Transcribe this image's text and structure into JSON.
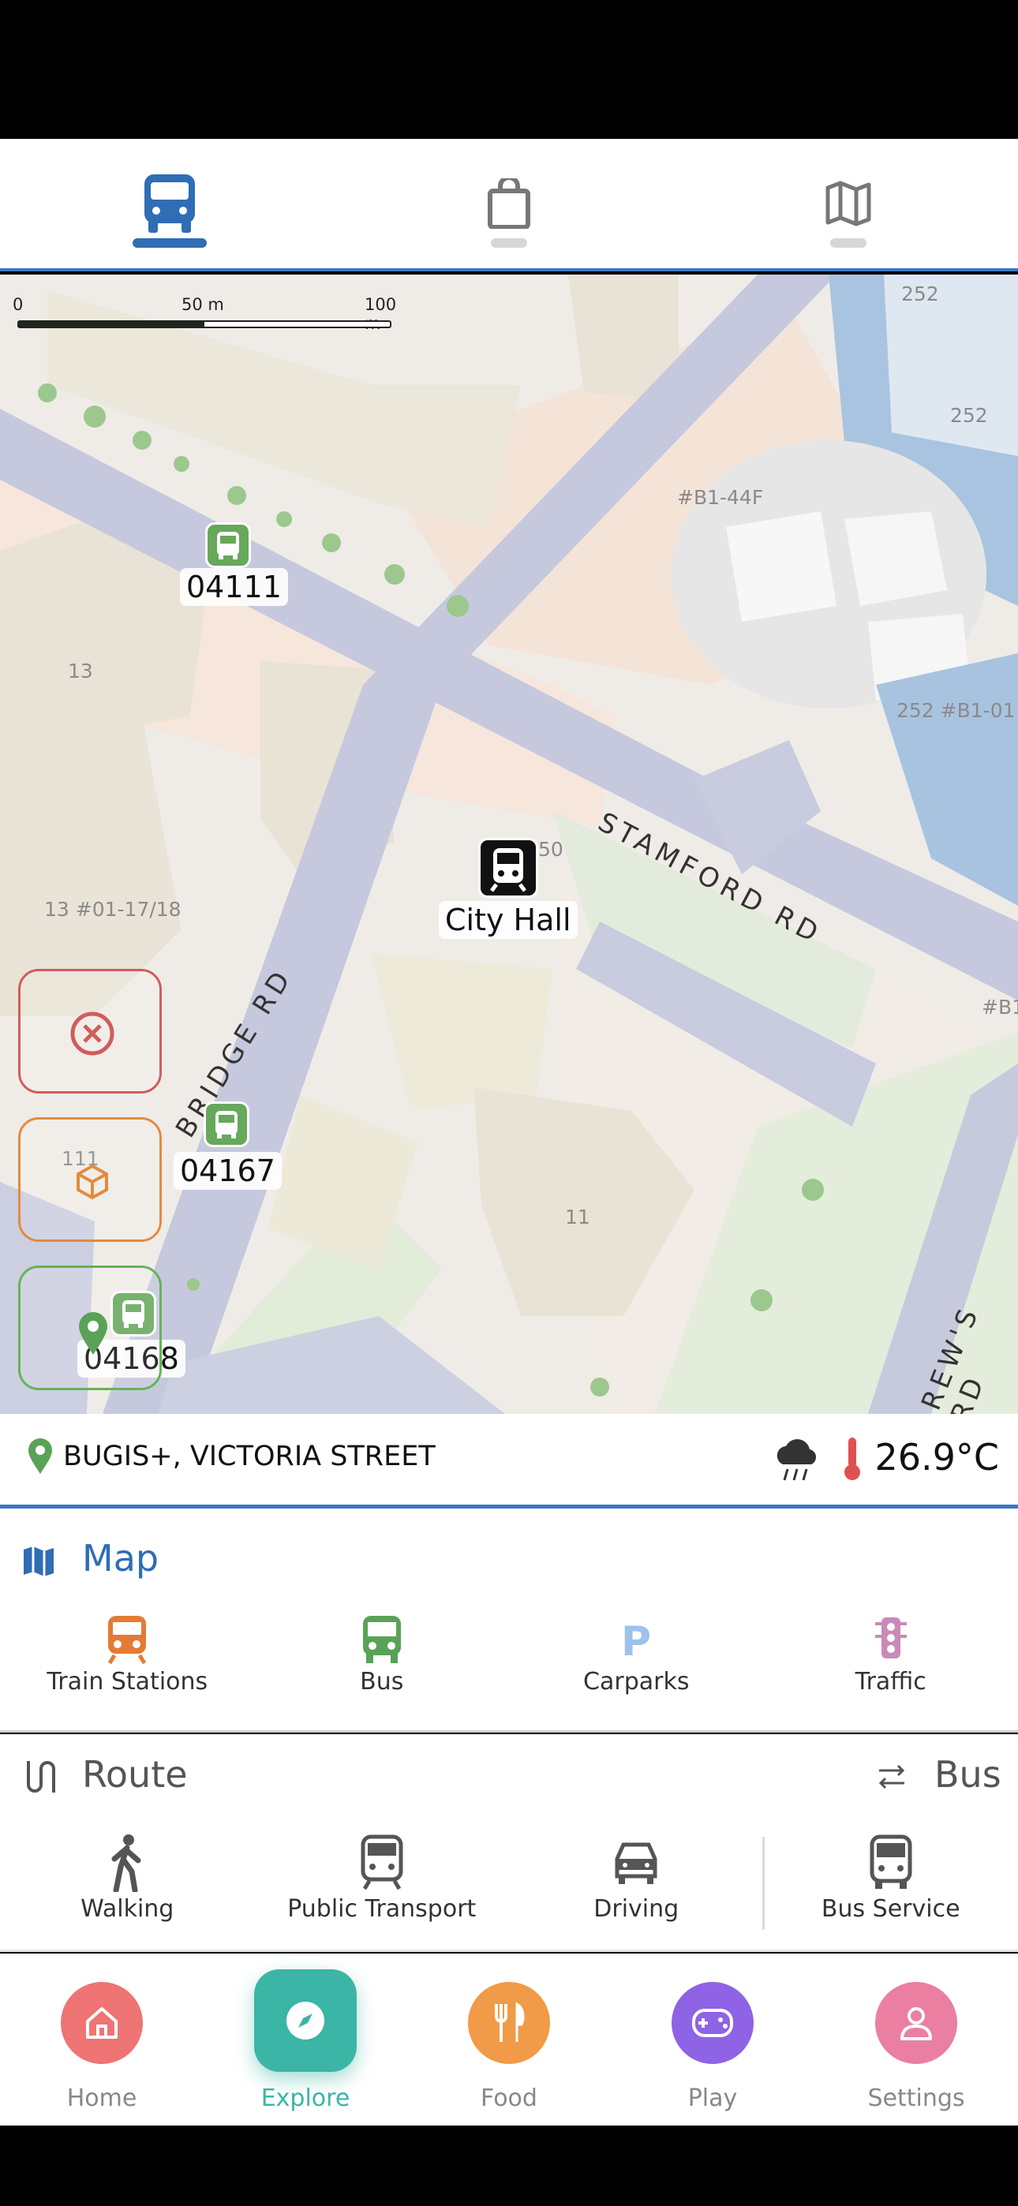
{
  "top_tabs": [
    {
      "name": "bus-icon",
      "active": true
    },
    {
      "name": "shopping-bag-icon",
      "active": false
    },
    {
      "name": "map-icon",
      "active": false
    }
  ],
  "map": {
    "scale": {
      "zero": "0",
      "mid": "50 m",
      "max": "100 m"
    },
    "stops": {
      "s1": "04111",
      "s2": "04167",
      "s3": "04168"
    },
    "station": "City Hall",
    "roads": {
      "stamford": "STAMFORD RD",
      "bridge": "BRIDGE RD",
      "andrews": "REW'S RD"
    },
    "buildings": {
      "b252a": "252",
      "b252b": "252",
      "b_b1_44f": "#B1-44F",
      "b252_b1_01": "252 #B1-01",
      "b13": "13",
      "b13_01": "13 #01-17/18",
      "b50": "50",
      "b11": "11",
      "b111": "111",
      "b_b1": "#B1"
    }
  },
  "location_bar": {
    "place": "BUGIS+, VICTORIA STREET",
    "temperature": "26.9°C",
    "weather_icon": "rain-cloud-icon"
  },
  "map_section": {
    "title": "Map",
    "items": [
      {
        "label": "Train Stations",
        "icon": "train-icon",
        "color": "#e47b35"
      },
      {
        "label": "Bus",
        "icon": "bus-icon",
        "color": "#5aa257"
      },
      {
        "label": "Carparks",
        "icon": "parking-icon",
        "color": "#9fc1ea"
      },
      {
        "label": "Traffic",
        "icon": "traffic-light-icon",
        "color": "#c98ab8"
      }
    ]
  },
  "route_section": {
    "title": "Route",
    "right_label": "Bus",
    "items": [
      {
        "label": "Walking",
        "icon": "walking-icon"
      },
      {
        "label": "Public Transport",
        "icon": "train-icon"
      },
      {
        "label": "Driving",
        "icon": "car-icon"
      },
      {
        "label": "Bus Service",
        "icon": "bus-icon"
      }
    ]
  },
  "bottom_nav": [
    {
      "label": "Home",
      "icon": "home-icon",
      "color": "#ef7474",
      "active": false
    },
    {
      "label": "Explore",
      "icon": "compass-icon",
      "color": "#3bb5a6",
      "active": true
    },
    {
      "label": "Food",
      "icon": "food-icon",
      "color": "#f19a47",
      "active": false
    },
    {
      "label": "Play",
      "icon": "gamepad-icon",
      "color": "#8e63e6",
      "active": false
    },
    {
      "label": "Settings",
      "icon": "user-icon",
      "color": "#ea7fa2",
      "active": false
    }
  ]
}
